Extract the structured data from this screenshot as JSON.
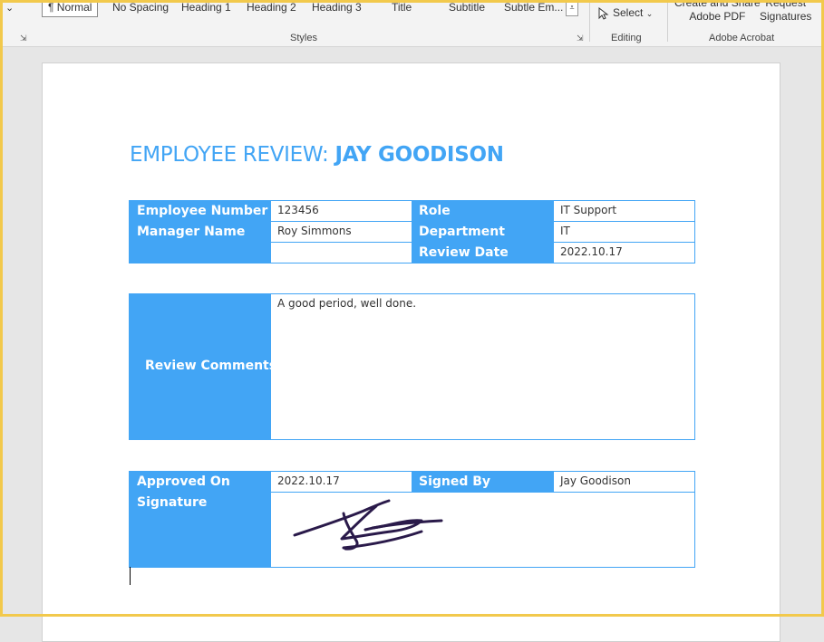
{
  "ribbon": {
    "styles": [
      "¶ Normal",
      "No Spacing",
      "Heading 1",
      "Heading 2",
      "Heading 3",
      "Title",
      "Subtitle",
      "Subtle Em..."
    ],
    "styles_group_label": "Styles",
    "select_label": "Select",
    "editing_group_label": "Editing",
    "create_share_line1": "Create and Share",
    "create_share_line2": "Adobe PDF",
    "request_sign_line1": "Request",
    "request_sign_line2": "Signatures",
    "acrobat_group_label": "Adobe Acrobat"
  },
  "document": {
    "title_prefix": "EMPLOYEE REVIEW: ",
    "title_name": "JAY GOODISON",
    "info": {
      "employee_number_label": "Employee Number",
      "employee_number": "123456",
      "manager_name_label": "Manager Name",
      "manager_name": "Roy Simmons",
      "role_label": "Role",
      "role": "IT Support",
      "department_label": "Department",
      "department": "IT",
      "review_date_label": "Review Date",
      "review_date": "2022.10.17"
    },
    "comments": {
      "label": "Review Comments",
      "text": "A good period, well done."
    },
    "approval": {
      "approved_on_label": "Approved On",
      "approved_on": "2022.10.17",
      "signed_by_label": "Signed By",
      "signed_by": "Jay Goodison",
      "signature_label": "Signature"
    }
  },
  "colors": {
    "accent": "#42a5f5",
    "signature_ink": "#2a1a4a"
  }
}
